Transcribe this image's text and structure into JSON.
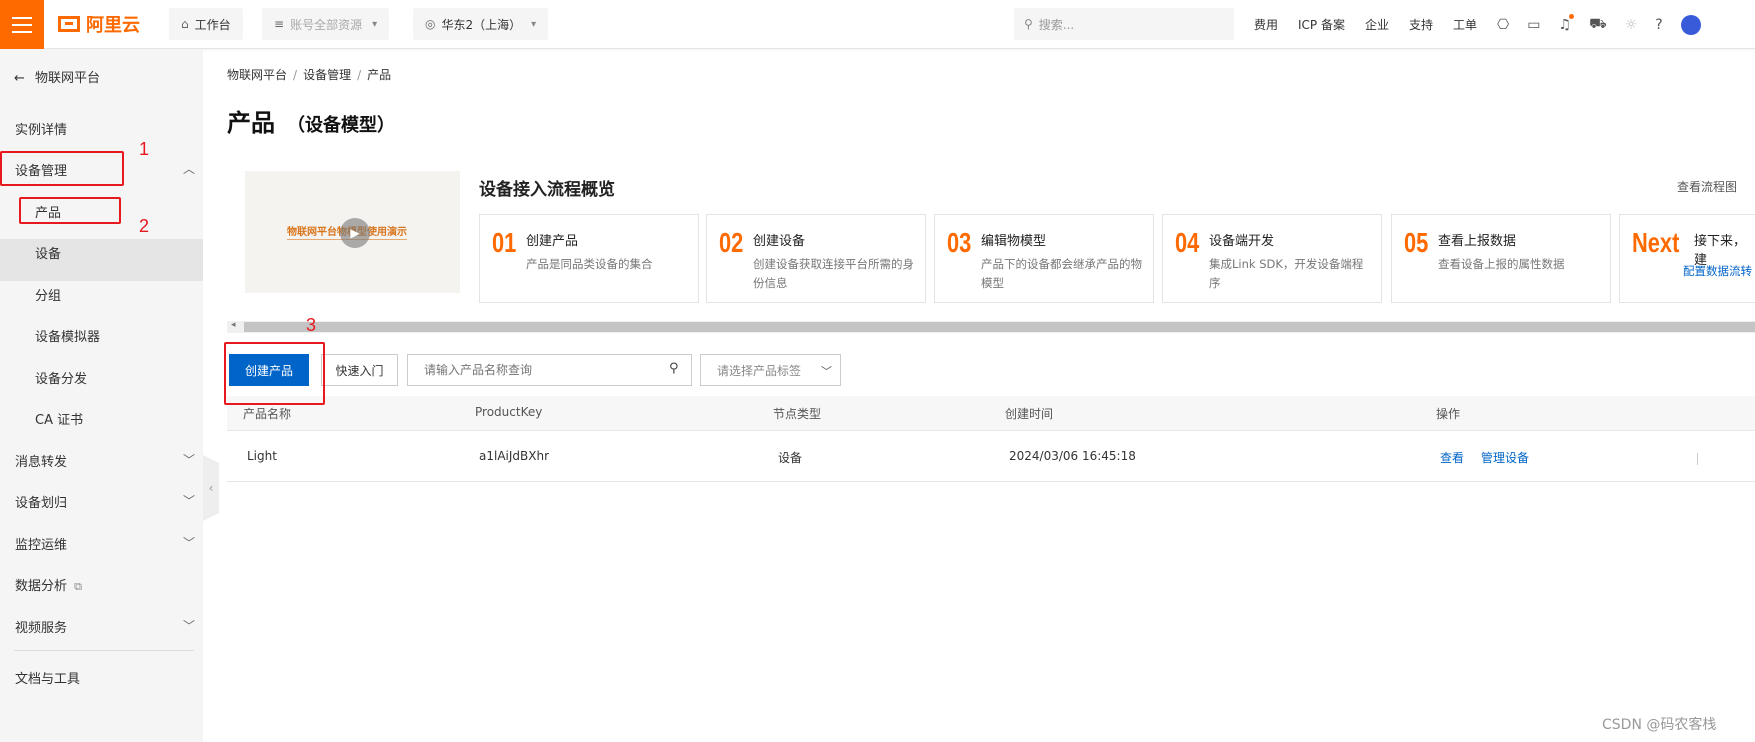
{
  "topbar": {
    "logo_text": "阿里云",
    "workbench_label": "工作台",
    "account_label": "账号全部资源",
    "region_label": "华东2（上海）",
    "search_placeholder": "搜索...",
    "links": [
      "费用",
      "ICP 备案",
      "企业",
      "支持",
      "工单"
    ]
  },
  "sidebar": {
    "back_label": "物联网平台",
    "items": [
      {
        "label": "实例详情"
      },
      {
        "label": "设备管理"
      },
      {
        "label": "消息转发"
      },
      {
        "label": "设备划归"
      },
      {
        "label": "监控运维"
      },
      {
        "label": "数据分析"
      },
      {
        "label": "视频服务"
      },
      {
        "label": "文档与工具"
      }
    ],
    "sub_items": [
      "产品",
      "设备",
      "分组",
      "设备模拟器",
      "设备分发",
      "CA 证书"
    ]
  },
  "breadcrumb": [
    "物联网平台",
    "设备管理",
    "产品"
  ],
  "page": {
    "title": "产品",
    "subtitle": "（设备模型）"
  },
  "flow": {
    "video_text": "物联网平台物模型使用演示",
    "title": "设备接入流程概览",
    "link": "查看流程图",
    "steps": [
      {
        "num": "01",
        "title": "创建产品",
        "desc": "产品是同品类设备的集合"
      },
      {
        "num": "02",
        "title": "创建设备",
        "desc": "创建设备获取连接平台所需的身份信息"
      },
      {
        "num": "03",
        "title": "编辑物模型",
        "desc": "产品下的设备都会继承产品的物模型"
      },
      {
        "num": "04",
        "title": "设备端开发",
        "desc": "集成Link SDK，开发设备端程序"
      },
      {
        "num": "05",
        "title": "查看上报数据",
        "desc": "查看设备上报的属性数据"
      },
      {
        "num": "Next",
        "title": "接下来，建",
        "link": "配置数据流转"
      }
    ]
  },
  "toolbar": {
    "create_label": "创建产品",
    "quickstart_label": "快速入门",
    "search_placeholder": "请输入产品名称查询",
    "tag_placeholder": "请选择产品标签"
  },
  "table": {
    "columns": [
      "产品名称",
      "ProductKey",
      "节点类型",
      "创建时间",
      "操作"
    ],
    "rows": [
      {
        "name": "Light",
        "key": "a1lAiJdBXhr",
        "node_type": "设备",
        "created": "2024/03/06 16:45:18",
        "actions": [
          "查看",
          "管理设备"
        ]
      }
    ]
  },
  "annotations": [
    "1",
    "2",
    "3"
  ],
  "watermark": "CSDN @码农客栈",
  "colors": {
    "brand": "#ff6a00",
    "primary": "#0064c8",
    "annotation": "#e8191e"
  }
}
